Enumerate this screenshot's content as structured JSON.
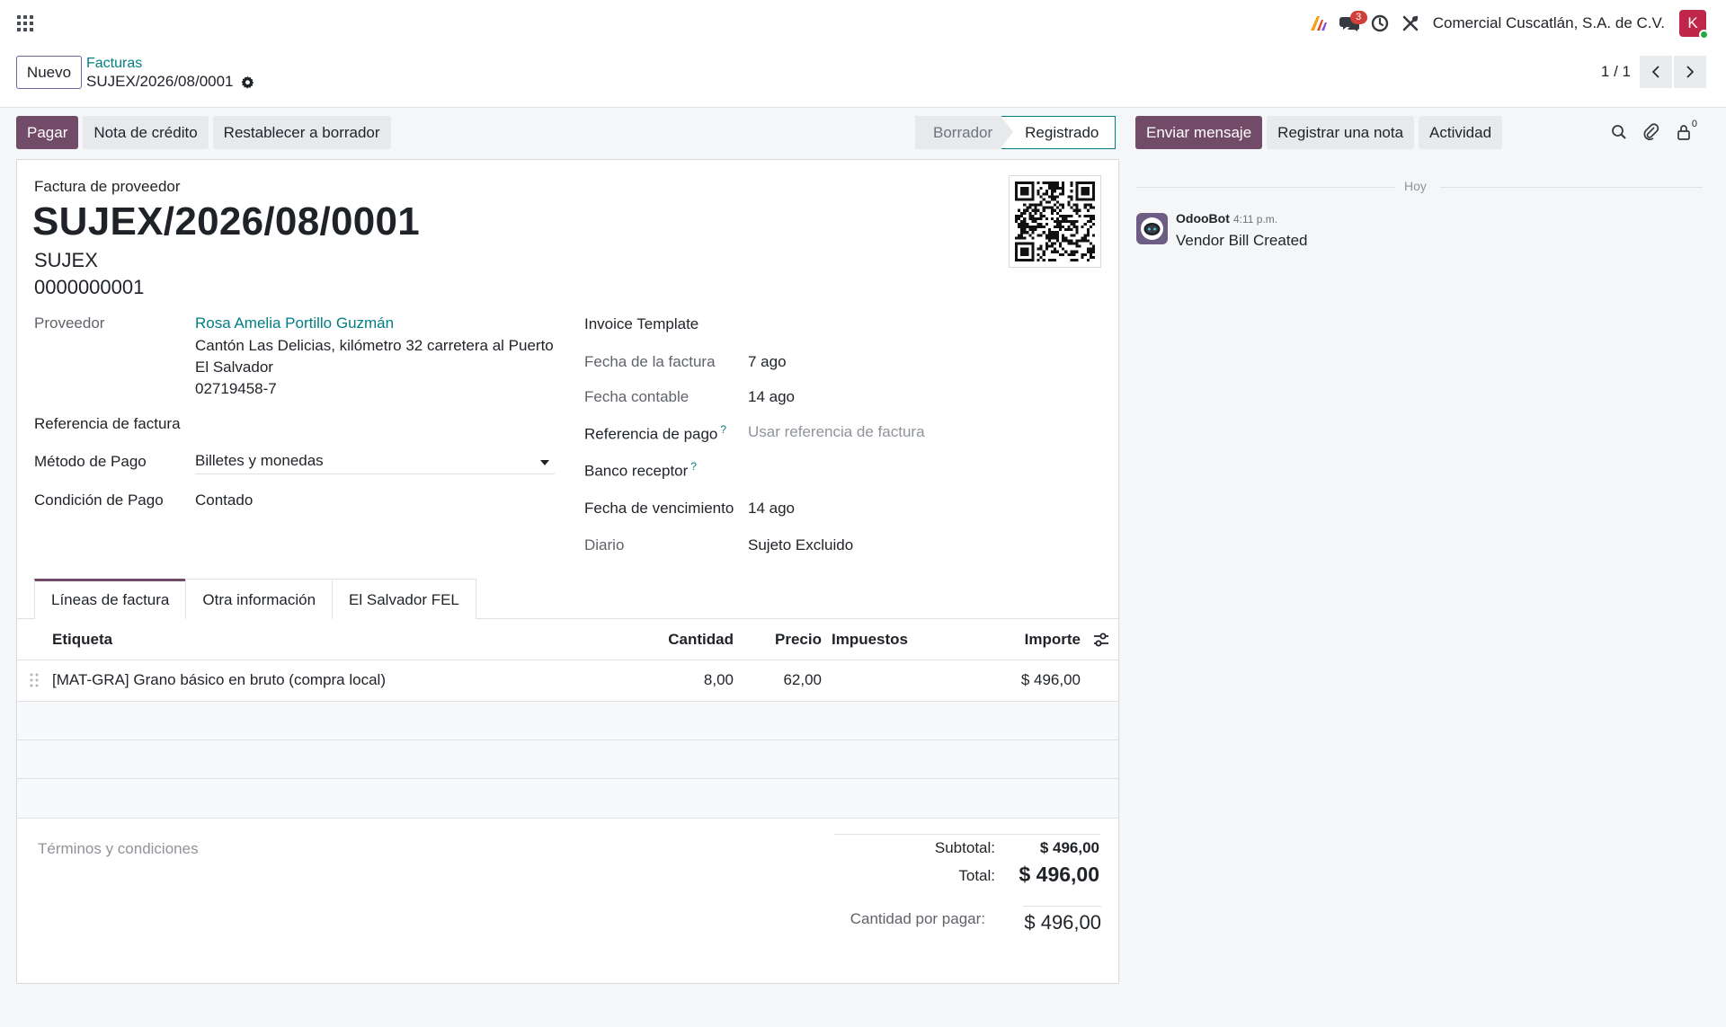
{
  "navbar": {
    "apps_icon": "apps-grid-icon",
    "message_count": "3",
    "company": "Comercial Cuscatlán, S.A. de C.V.",
    "avatar_initial": "K"
  },
  "control_panel": {
    "new_label": "Nuevo",
    "breadcrumb_parent": "Facturas",
    "breadcrumb_current": "SUJEX/2026/08/0001",
    "pager_value": "1 / 1"
  },
  "actions": {
    "pay": "Pagar",
    "credit_note": "Nota de crédito",
    "reset_draft": "Restablecer a borrador"
  },
  "statusbar": {
    "draft": "Borrador",
    "posted": "Registrado"
  },
  "header": {
    "doc_type": "Factura de proveedor",
    "name": "SUJEX/2026/08/0001",
    "prefix": "SUJEX",
    "number": "0000000001"
  },
  "left_fields": {
    "vendor_label": "Proveedor",
    "vendor_name": "Rosa Amelia Portillo Guzmán",
    "vendor_address1": "Cantón Las Delicias, kilómetro 32 carretera al Puerto",
    "vendor_address2": "El Salvador",
    "vendor_vat": "02719458-7",
    "ref_label": "Referencia de factura",
    "method_label": "Método de Pago",
    "method_value": "Billetes y monedas",
    "term_label": "Condición de Pago",
    "term_value": "Contado"
  },
  "right_fields": {
    "template_label": "Invoice Template",
    "invoice_date_label": "Fecha de la factura",
    "invoice_date_value": "7 ago",
    "acc_date_label": "Fecha contable",
    "acc_date_value": "14 ago",
    "pay_ref_label": "Referencia de pago",
    "pay_ref_placeholder": "Usar referencia de factura",
    "bank_label": "Banco receptor",
    "due_label": "Fecha de vencimiento",
    "due_value": "14 ago",
    "journal_label": "Diario",
    "journal_value": "Sujeto Excluido",
    "help_mark": "?"
  },
  "tabs": [
    "Líneas de factura",
    "Otra información",
    "El Salvador FEL"
  ],
  "lines": {
    "headers": {
      "label": "Etiqueta",
      "qty": "Cantidad",
      "price": "Precio",
      "taxes": "Impuestos",
      "amount": "Importe"
    },
    "rows": [
      {
        "label": "[MAT-GRA] Grano básico en bruto (compra local)",
        "qty": "8,00",
        "price": "62,00",
        "taxes": "",
        "amount": "$ 496,00"
      }
    ]
  },
  "totals": {
    "terms_placeholder": "Términos y condiciones",
    "subtotal_label": "Subtotal:",
    "subtotal_value": "$ 496,00",
    "total_label": "Total:",
    "total_value": "$ 496,00",
    "due_label": "Cantidad por pagar:",
    "due_value": "$ 496,00"
  },
  "chatter": {
    "send_message": "Enviar mensaje",
    "log_note": "Registrar una nota",
    "activity": "Actividad",
    "follower_count": "0",
    "today": "Hoy",
    "messages": [
      {
        "author": "OdooBot",
        "time": "4:11 p.m.",
        "body": "Vendor Bill Created"
      }
    ]
  },
  "colors": {
    "brand": "#714b67",
    "link": "#017e84",
    "badge": "#d23f3a",
    "avatar": "#c0254a"
  }
}
